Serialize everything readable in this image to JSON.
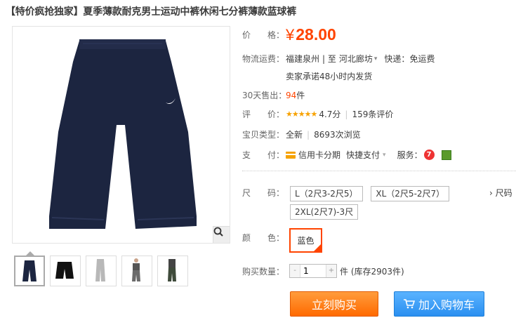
{
  "product": {
    "title": "【特价疯抢独家】夏季薄款耐克男士运动中裤休闲七分裤薄款蓝球裤"
  },
  "price": {
    "label": "价　　格：",
    "currency": "¥",
    "value": "28.00"
  },
  "shipping": {
    "label": "物流运费：",
    "from": "福建泉州",
    "to_prefix": "| 至",
    "to": "河北廊坊",
    "fee_label": "快递：",
    "fee": "免运费",
    "promise": "卖家承诺48小时内发货"
  },
  "sales": {
    "label": "30天售出：",
    "count": "94",
    "unit": "件"
  },
  "rating": {
    "label": "评　　价：",
    "stars": "★★★★★",
    "score": "4.7分",
    "sep": "|",
    "reviews": "159条评价"
  },
  "item_type": {
    "label": "宝贝类型：",
    "condition": "全新",
    "sep": "|",
    "views": "8693次浏览"
  },
  "payment": {
    "label": "支　　付：",
    "method1": "信用卡分期",
    "method2": "快捷支付",
    "service_label": "服务："
  },
  "size": {
    "label": "尺　　码：",
    "options": [
      "L（2尺3-2尺5）",
      "XL（2尺5-2尺7）",
      "2XL(2尺7)-3尺"
    ],
    "chart_link": "› 尺码"
  },
  "color": {
    "label": "颜　　色：",
    "selected": "蓝色"
  },
  "quantity": {
    "label": "购买数量：",
    "value": "1",
    "stock": "件 (库存2903件)"
  },
  "buttons": {
    "buy": "立刻购买",
    "cart": "加入购物车"
  },
  "colors": {
    "accent": "#ff4400",
    "blue": "#2a8ff0",
    "pants_navy": "#1c2540"
  }
}
